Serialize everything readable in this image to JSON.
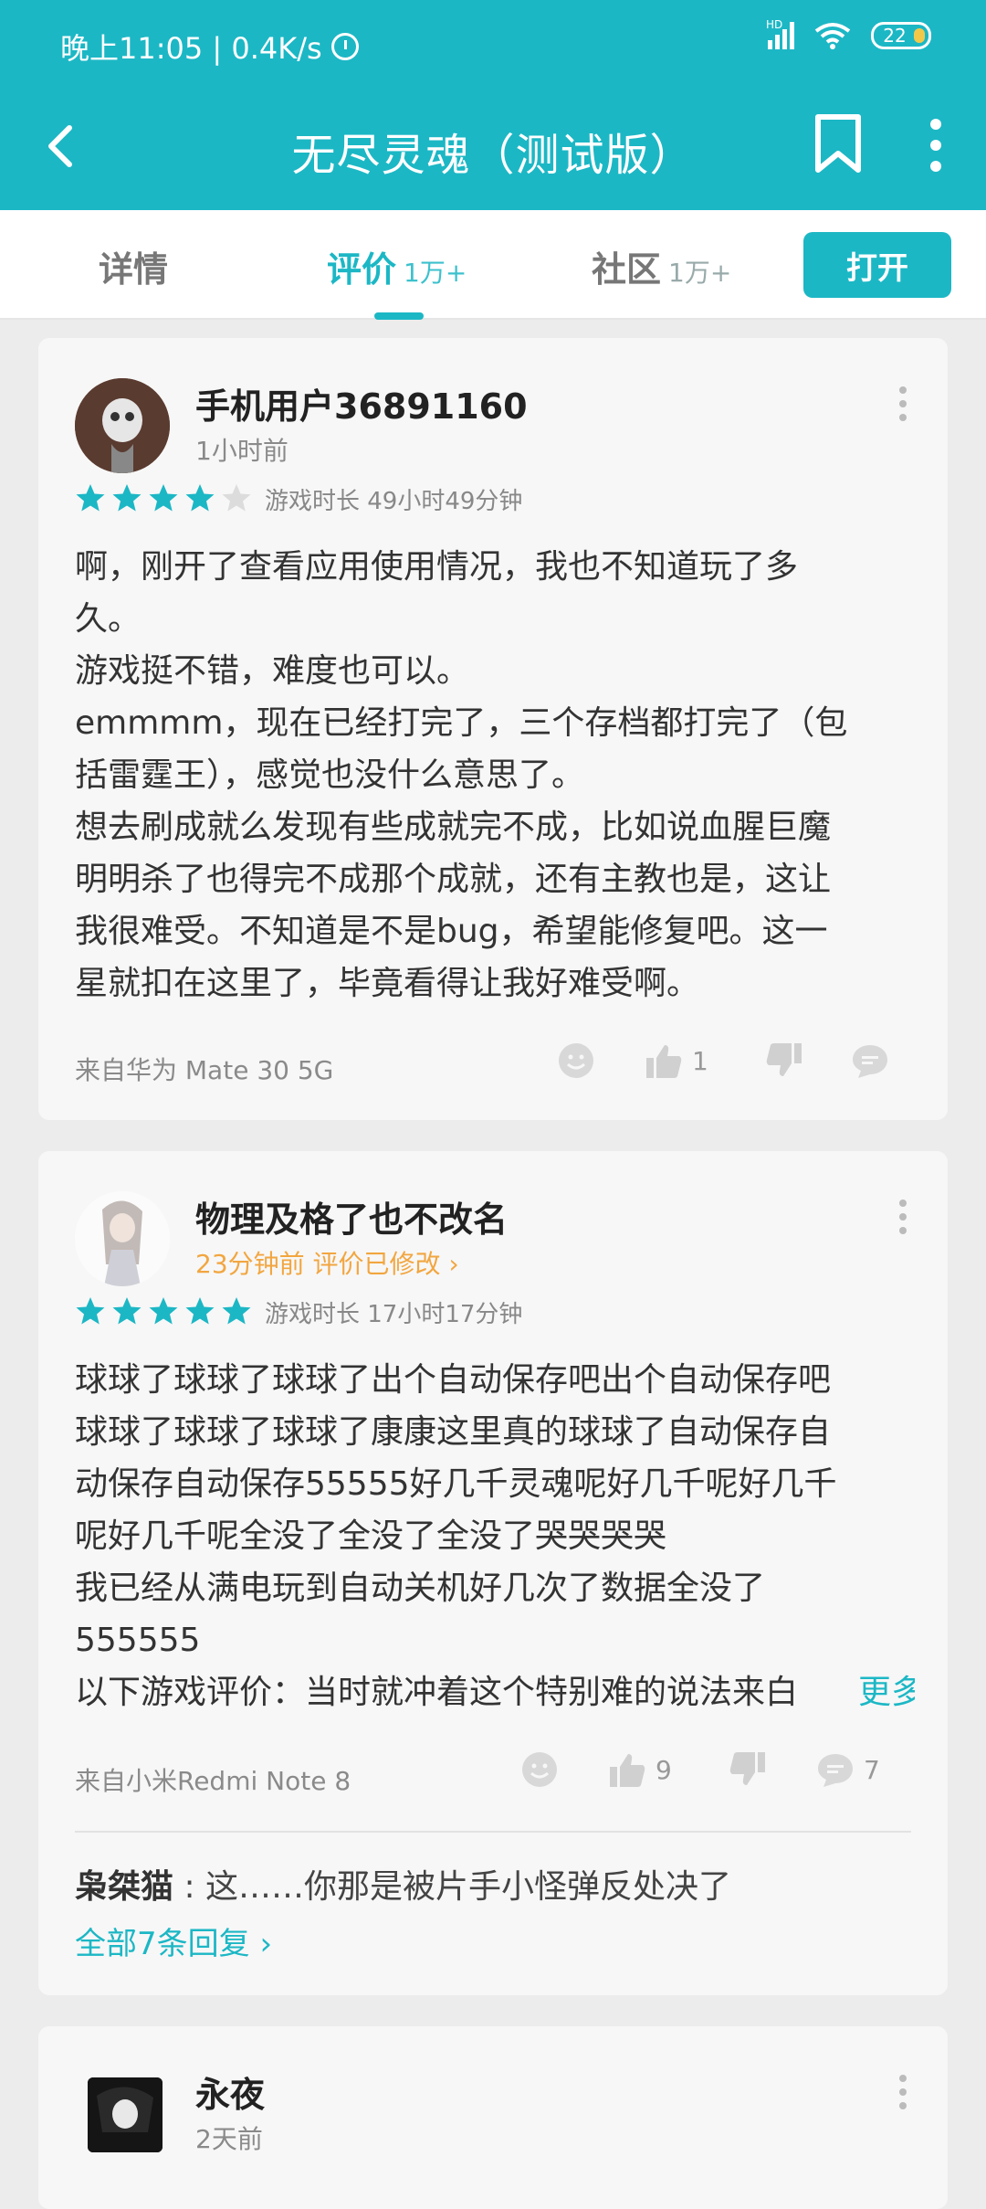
{
  "status_bar": {
    "time": "晚上11:05 | 0.4K/s",
    "signal_label": "HD",
    "battery": "22"
  },
  "app_bar": {
    "title": "无尽灵魂（测试版）"
  },
  "tabs": [
    {
      "label": "详情",
      "count": ""
    },
    {
      "label": "评价",
      "count": "1万+"
    },
    {
      "label": "社区",
      "count": "1万+"
    }
  ],
  "open_button": "打开",
  "reviews": [
    {
      "user": "手机用户36891160",
      "time": "1小时前",
      "stars": 4,
      "playtime": "游戏时长 49小时49分钟",
      "content": [
        "啊，刚开了查看应用使用情况，我也不知道玩了多",
        "久。",
        "游戏挺不错，难度也可以。",
        "emmmm，现在已经打完了，三个存档都打完了（包",
        "括雷霆王），感觉也没什么意思了。",
        "想去刷成就么发现有些成就完不成，比如说血腥巨魔",
        "明明杀了也得完不成那个成就，还有主教也是，这让",
        "我很难受。不知道是不是bug，希望能修复吧。这一",
        "星就扣在这里了，毕竟看得让我好难受啊。"
      ],
      "device": "来自华为 Mate 30 5G",
      "likes": "1",
      "comments": ""
    },
    {
      "user": "物理及格了也不改名",
      "time": "23分钟前 评价已修改",
      "stars": 5,
      "playtime": "游戏时长 17小时17分钟",
      "content": [
        "球球了球球了球球了出个自动保存吧出个自动保存吧",
        "球球了球球了球球了康康这里真的球球了自动保存自",
        "动保存自动保存55555好几千灵魂呢好几千呢好几千",
        "呢好几千呢全没了全没了全没了哭哭哭哭",
        "我已经从满电玩到自动关机好几次了数据全没了",
        "555555",
        "以下游戏评价：当时就冲着这个特别难的说法来白"
      ],
      "more": "更多",
      "device": "来自小米Redmi Note 8",
      "likes": "9",
      "comments": "7",
      "reply_user": "枭桀猫",
      "reply_text": " : 这……你那是被片手小怪弹反处决了",
      "all_replies": "全部7条回复"
    },
    {
      "user": "永夜",
      "time": "2天前"
    }
  ],
  "colors": {
    "accent": "#1cb7c5",
    "star_empty": "#dcdcdc",
    "orange": "#f2a640"
  }
}
